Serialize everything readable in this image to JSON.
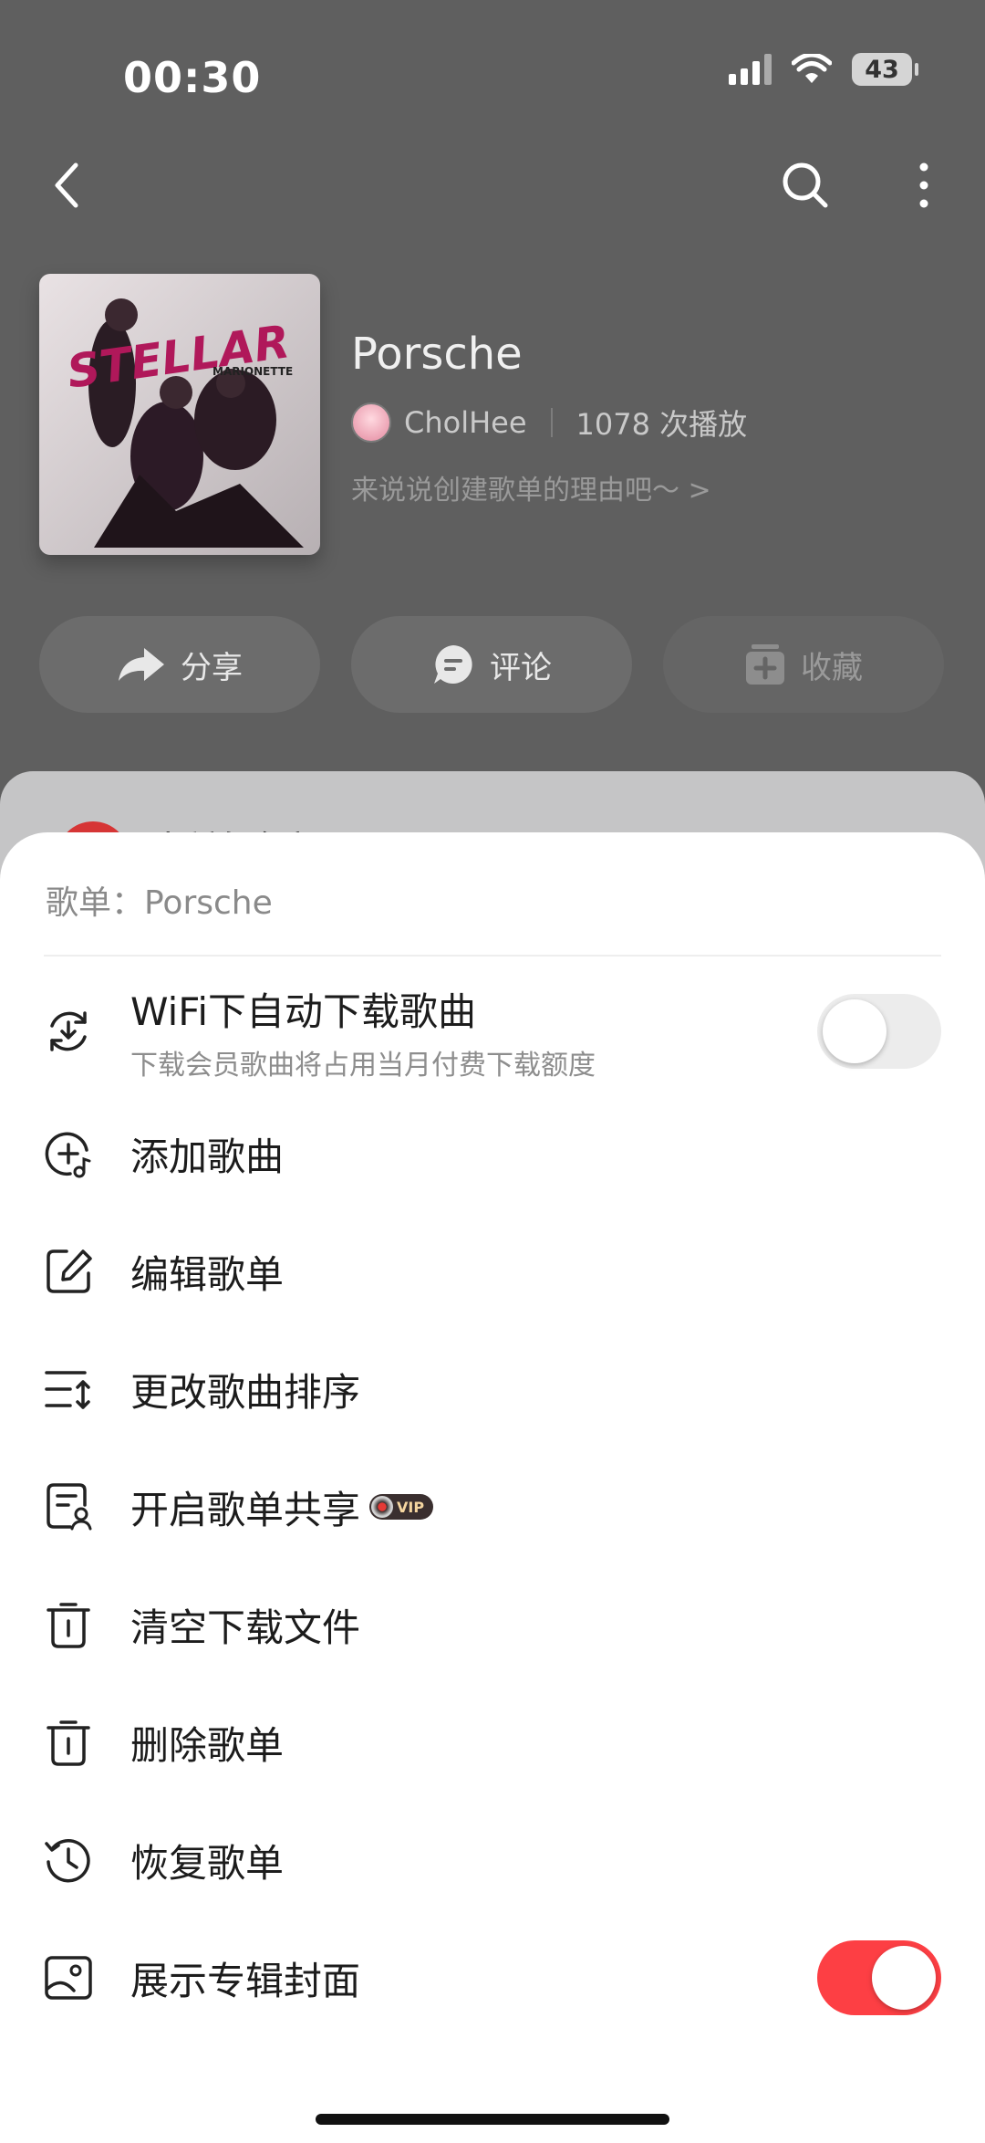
{
  "status": {
    "time": "00:30",
    "battery": "43"
  },
  "header": {
    "title": "Porsche",
    "creator": "CholHee",
    "plays": "1078 次播放",
    "description": "来说说创建歌单的理由吧～ >",
    "cover_text": "STELLAR",
    "cover_sub": "MARIONETTE"
  },
  "actions": [
    {
      "label": "分享"
    },
    {
      "label": "评论"
    },
    {
      "label": "收藏"
    }
  ],
  "underlying": {
    "peek_text": "播放全部"
  },
  "sheet": {
    "title": "歌单：Porsche",
    "items": [
      {
        "label": "WiFi下自动下载歌曲",
        "sub": "下载会员歌曲将占用当月付费下载额度",
        "toggle": false
      },
      {
        "label": "添加歌曲"
      },
      {
        "label": "编辑歌单"
      },
      {
        "label": "更改歌曲排序"
      },
      {
        "label": "开启歌单共享",
        "badge": "VIP"
      },
      {
        "label": "清空下载文件"
      },
      {
        "label": "删除歌单"
      },
      {
        "label": "恢复歌单"
      },
      {
        "label": "展示专辑封面",
        "toggle": true
      }
    ]
  },
  "colors": {
    "accent": "#fd3f44",
    "toggle_off": "#ececec"
  }
}
